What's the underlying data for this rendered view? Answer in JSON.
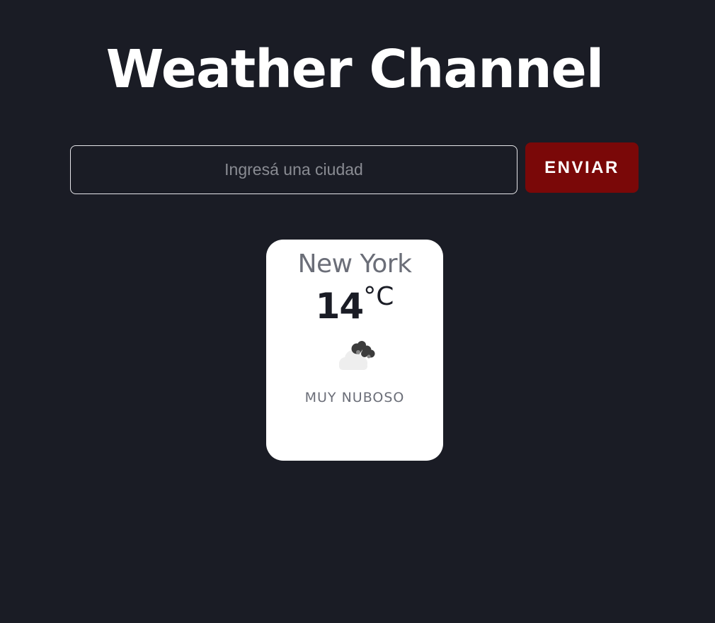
{
  "header": {
    "title": "Weather Channel"
  },
  "search": {
    "value": "",
    "placeholder": "Ingresá una ciudad",
    "submit_label": "ENVIAR"
  },
  "weather": {
    "city": "New York",
    "temperature": "14",
    "unit": "°C",
    "icon": "broken-clouds-icon",
    "description": "MUY NUBOSO"
  },
  "colors": {
    "background": "#1a1c25",
    "button": "#7a0808",
    "card": "#ffffff"
  }
}
